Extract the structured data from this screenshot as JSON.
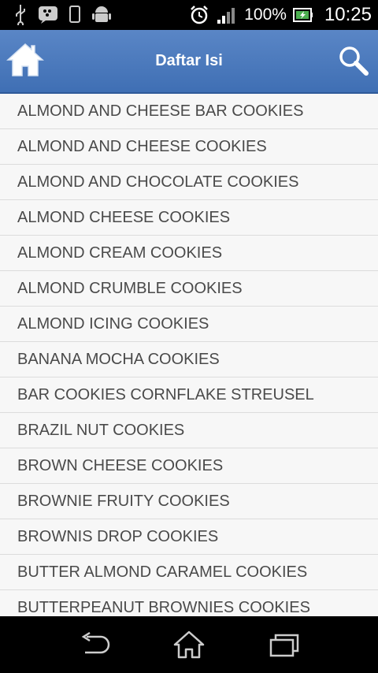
{
  "status": {
    "battery": "100%",
    "time": "10:25"
  },
  "header": {
    "title": "Daftar Isi"
  },
  "items": [
    "ALMOND AND CHEESE BAR COOKIES",
    "ALMOND AND CHEESE COOKIES",
    "ALMOND AND CHOCOLATE COOKIES",
    "ALMOND CHEESE COOKIES",
    "ALMOND CREAM COOKIES",
    "ALMOND CRUMBLE COOKIES",
    "ALMOND ICING COOKIES",
    "BANANA MOCHA COOKIES",
    "BAR COOKIES CORNFLAKE STREUSEL",
    "BRAZIL NUT COOKIES",
    "BROWN CHEESE COOKIES",
    "BROWNIE FRUITY COOKIES",
    "BROWNIS DROP COOKIES",
    "BUTTER ALMOND CARAMEL COOKIES",
    "BUTTERPEANUT BROWNIES COOKIES"
  ],
  "colors": {
    "appbar": "#4a79bd",
    "text": "#4a4a4a"
  }
}
